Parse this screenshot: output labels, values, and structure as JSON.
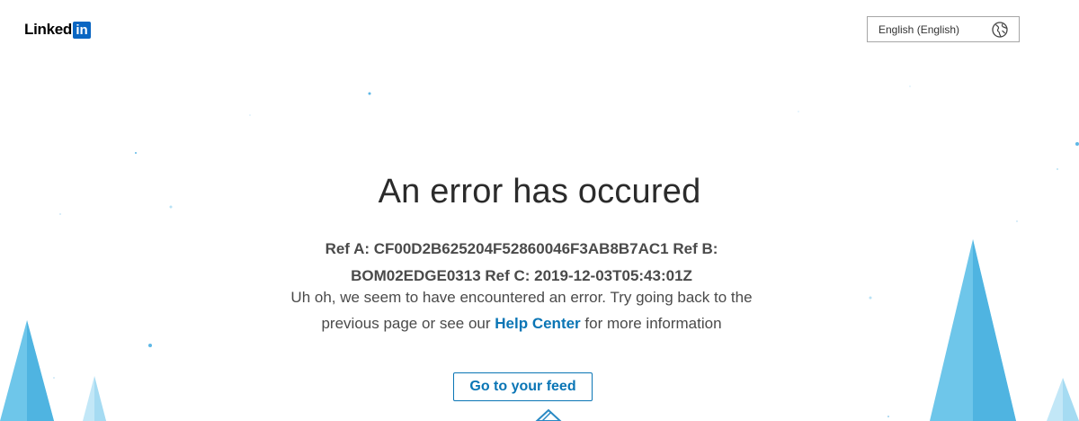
{
  "header": {
    "logo_text": "Linked",
    "logo_box_text": "in",
    "language_label": "English (English)",
    "language_icon": "globe-icon"
  },
  "main": {
    "headline": "An error has occured",
    "ref_line": "Ref A: CF00D2B625204F52860046F3AB8B7AC1 Ref B: BOM02EDGE0313 Ref C: 2019-12-03T05:43:01Z",
    "message_before": "Uh oh, we seem to have encountered an error. Try going back to the previous page or see our ",
    "help_link": "Help Center",
    "message_after": " for more information",
    "button_label": "Go to your feed"
  },
  "colors": {
    "brand_blue": "#0a66c2",
    "link_blue": "#0a75b5",
    "tree_blue": "#5fc1e8",
    "tree_light_blue": "#a8dcf3"
  }
}
